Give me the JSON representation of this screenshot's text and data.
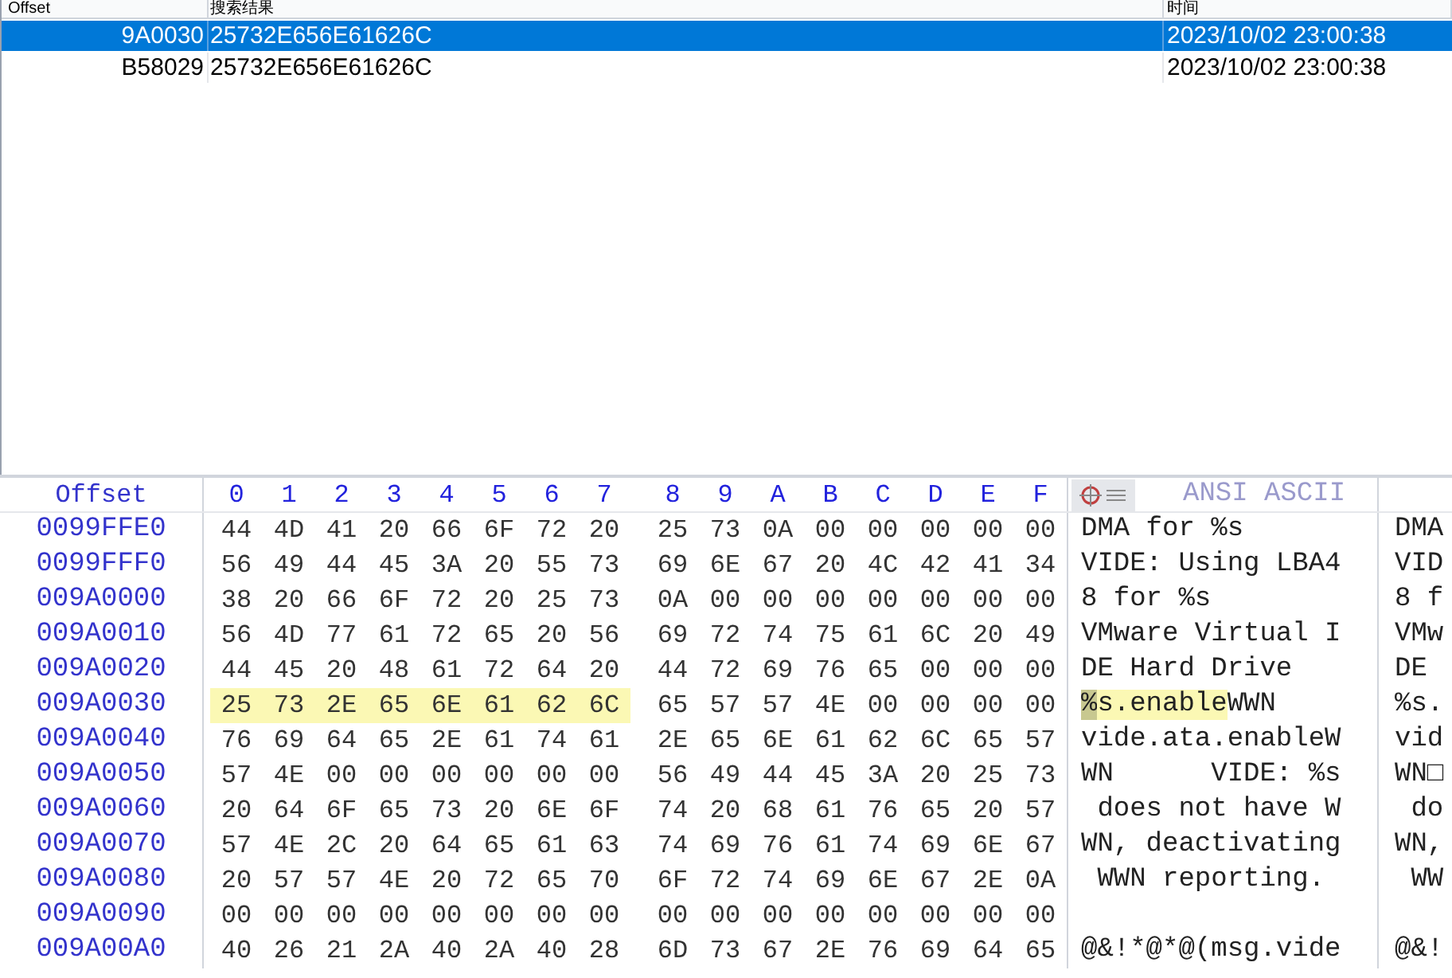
{
  "results": {
    "columns": [
      "Offset",
      "搜索结果",
      "时间"
    ],
    "rows": [
      {
        "offset": "9A0030",
        "result": "25732E656E61626C",
        "time": "2023/10/02  23:00:38",
        "selected": true
      },
      {
        "offset": "B58029",
        "result": "25732E656E61626C",
        "time": "2023/10/02  23:00:38",
        "selected": false
      }
    ]
  },
  "hex": {
    "offset_header": "Offset",
    "columns": [
      "0",
      "1",
      "2",
      "3",
      "4",
      "5",
      "6",
      "7",
      "8",
      "9",
      "A",
      "B",
      "C",
      "D",
      "E",
      "F"
    ],
    "text_header": "ANSI ASCII",
    "rows": [
      {
        "offset": "0099FFE0",
        "hex": [
          "44 4D 41 20 66 6F 72 20",
          "25 73 0A 00 00 00 00 00"
        ],
        "hex_highlighted": [
          false,
          false
        ],
        "ascii": [
          {
            "text": "DMA for %s",
            "highlighted": false,
            "cursor": false
          }
        ],
        "ascii2": "DMA"
      },
      {
        "offset": "0099FFF0",
        "hex": [
          "56 49 44 45 3A 20 55 73",
          "69 6E 67 20 4C 42 41 34"
        ],
        "hex_highlighted": [
          false,
          false
        ],
        "ascii": [
          {
            "text": "VIDE: Using LBA4",
            "highlighted": false,
            "cursor": false
          }
        ],
        "ascii2": "VID"
      },
      {
        "offset": "009A0000",
        "hex": [
          "38 20 66 6F 72 20 25 73",
          "0A 00 00 00 00 00 00 00"
        ],
        "hex_highlighted": [
          false,
          false
        ],
        "ascii": [
          {
            "text": "8 for %s",
            "highlighted": false,
            "cursor": false
          }
        ],
        "ascii2": "8 f"
      },
      {
        "offset": "009A0010",
        "hex": [
          "56 4D 77 61 72 65 20 56",
          "69 72 74 75 61 6C 20 49"
        ],
        "hex_highlighted": [
          false,
          false
        ],
        "ascii": [
          {
            "text": "VMware Virtual I",
            "highlighted": false,
            "cursor": false
          }
        ],
        "ascii2": "VMw"
      },
      {
        "offset": "009A0020",
        "hex": [
          "44 45 20 48 61 72 64 20",
          "44 72 69 76 65 00 00 00"
        ],
        "hex_highlighted": [
          false,
          false
        ],
        "ascii": [
          {
            "text": "DE Hard Drive",
            "highlighted": false,
            "cursor": false
          }
        ],
        "ascii2": "DE"
      },
      {
        "offset": "009A0030",
        "hex": [
          "25 73 2E 65 6E 61 62 6C",
          "65 57 57 4E 00 00 00 00"
        ],
        "hex_highlighted": [
          true,
          false
        ],
        "ascii": [
          {
            "text": "%",
            "highlighted": true,
            "cursor": true
          },
          {
            "text": "s.enable",
            "highlighted": true,
            "cursor": false
          },
          {
            "text": "WWN",
            "highlighted": false,
            "cursor": false
          }
        ],
        "ascii2": "%s."
      },
      {
        "offset": "009A0040",
        "hex": [
          "76 69 64 65 2E 61 74 61",
          "2E 65 6E 61 62 6C 65 57"
        ],
        "hex_highlighted": [
          false,
          false
        ],
        "ascii": [
          {
            "text": "vide.ata.enableW",
            "highlighted": false,
            "cursor": false
          }
        ],
        "ascii2": "vid"
      },
      {
        "offset": "009A0050",
        "hex": [
          "57 4E 00 00 00 00 00 00",
          "56 49 44 45 3A 20 25 73"
        ],
        "hex_highlighted": [
          false,
          false
        ],
        "ascii": [
          {
            "text": "WN      VIDE: %s",
            "highlighted": false,
            "cursor": false
          }
        ],
        "ascii2": "WN□"
      },
      {
        "offset": "009A0060",
        "hex": [
          "20 64 6F 65 73 20 6E 6F",
          "74 20 68 61 76 65 20 57"
        ],
        "hex_highlighted": [
          false,
          false
        ],
        "ascii": [
          {
            "text": " does not have W",
            "highlighted": false,
            "cursor": false
          }
        ],
        "ascii2": " do"
      },
      {
        "offset": "009A0070",
        "hex": [
          "57 4E 2C 20 64 65 61 63",
          "74 69 76 61 74 69 6E 67"
        ],
        "hex_highlighted": [
          false,
          false
        ],
        "ascii": [
          {
            "text": "WN, deactivating",
            "highlighted": false,
            "cursor": false
          }
        ],
        "ascii2": "WN,"
      },
      {
        "offset": "009A0080",
        "hex": [
          "20 57 57 4E 20 72 65 70",
          "6F 72 74 69 6E 67 2E 0A"
        ],
        "hex_highlighted": [
          false,
          false
        ],
        "ascii": [
          {
            "text": " WWN reporting.",
            "highlighted": false,
            "cursor": false
          }
        ],
        "ascii2": " WW"
      },
      {
        "offset": "009A0090",
        "hex": [
          "00 00 00 00 00 00 00 00",
          "00 00 00 00 00 00 00 00"
        ],
        "hex_highlighted": [
          false,
          false
        ],
        "ascii": []
      },
      {
        "offset": "009A00A0",
        "hex": [
          "40 26 21 2A 40 2A 40 28",
          "6D 73 67 2E 76 69 64 65"
        ],
        "hex_highlighted": [
          false,
          false
        ],
        "ascii": [
          {
            "text": "@&!*@*@(msg.vide",
            "highlighted": false,
            "cursor": false
          }
        ],
        "ascii2": "@&!"
      }
    ]
  }
}
